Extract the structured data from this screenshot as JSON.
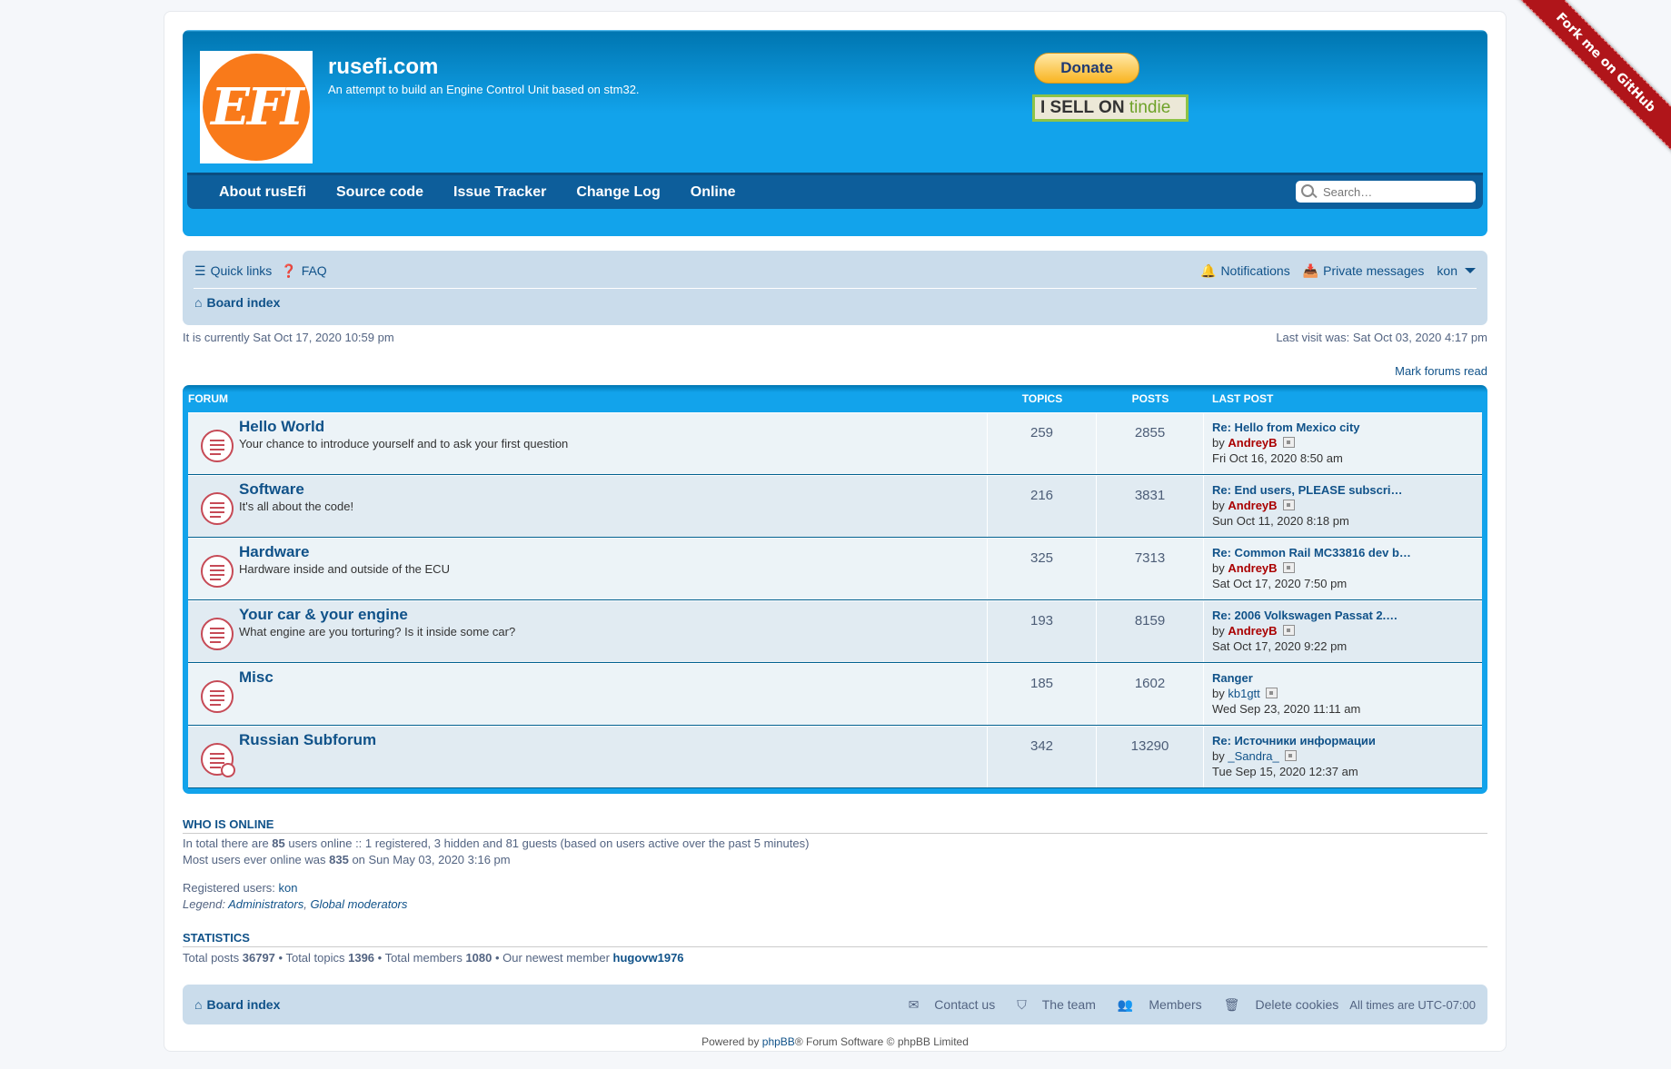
{
  "site": {
    "title": "rusefi.com",
    "description": "An attempt to build an Engine Control Unit based on stm32.",
    "logo_text": "EFI",
    "donate_label": "Donate",
    "tindie_prefix": "I SELL ON ",
    "tindie_brand": "tindie",
    "ribbon": "Fork me on GitHub"
  },
  "nav": {
    "items": [
      "About rusEfi",
      "Source code",
      "Issue Tracker",
      "Change Log",
      "Online"
    ],
    "search_placeholder": "Search…"
  },
  "crumbs": {
    "quick_links": "Quick links",
    "faq": "FAQ",
    "notifications": "Notifications",
    "private_messages": "Private messages",
    "username": "kon",
    "board_index": "Board index"
  },
  "time": {
    "current": "It is currently Sat Oct 17, 2020 10:59 pm",
    "last_visit": "Last visit was: Sat Oct 03, 2020 4:17 pm",
    "mark_read": "Mark forums read"
  },
  "forum_table": {
    "headers": [
      "Forum",
      "Topics",
      "Posts",
      "Last post"
    ],
    "rows": [
      {
        "title": "Hello World",
        "desc": "Your chance to introduce yourself and to ask your first question",
        "topics": "259",
        "posts": "2855",
        "last_title": "Re: Hello from Mexico city",
        "by": "by",
        "author": "AndreyB",
        "author_role": "admin",
        "date": "Fri Oct 16, 2020 8:50 am"
      },
      {
        "title": "Software",
        "desc": "It's all about the code!",
        "topics": "216",
        "posts": "3831",
        "last_title": "Re: End users, PLEASE subscri…",
        "by": "by",
        "author": "AndreyB",
        "author_role": "admin",
        "date": "Sun Oct 11, 2020 8:18 pm"
      },
      {
        "title": "Hardware",
        "desc": "Hardware inside and outside of the ECU",
        "topics": "325",
        "posts": "7313",
        "last_title": "Re: Common Rail MC33816 dev b…",
        "by": "by",
        "author": "AndreyB",
        "author_role": "admin",
        "date": "Sat Oct 17, 2020 7:50 pm"
      },
      {
        "title": "Your car & your engine",
        "desc": "What engine are you torturing? Is it inside some car?",
        "topics": "193",
        "posts": "8159",
        "last_title": "Re: 2006 Volkswagen Passat 2.…",
        "by": "by",
        "author": "AndreyB",
        "author_role": "admin",
        "date": "Sat Oct 17, 2020 9:22 pm"
      },
      {
        "title": "Misc",
        "desc": "",
        "topics": "185",
        "posts": "1602",
        "last_title": "Ranger",
        "by": "by",
        "author": "kb1gtt",
        "author_role": "user",
        "date": "Wed Sep 23, 2020 11:11 am"
      },
      {
        "title": "Russian Subforum",
        "desc": "",
        "topics": "342",
        "posts": "13290",
        "last_title": "Re: Источники информации",
        "by": "by",
        "author": "_Sandra_",
        "author_role": "user",
        "date": "Tue Sep 15, 2020 12:37 am"
      }
    ]
  },
  "online": {
    "heading": "Who is online",
    "line1_pre": "In total there are ",
    "line1_count": "85",
    "line1_post": " users online :: 1 registered, 3 hidden and 81 guests (based on users active over the past 5 minutes)",
    "line2_pre": "Most users ever online was ",
    "line2_count": "835",
    "line2_post": " on Sun May 03, 2020 3:16 pm",
    "registered_label": "Registered users: ",
    "registered_user": "kon",
    "legend_label": "Legend: ",
    "legend_admin": "Administrators",
    "legend_sep": ", ",
    "legend_mod": "Global moderators"
  },
  "stats": {
    "heading": "Statistics",
    "posts_label": "Total posts ",
    "posts": "36797",
    "topics_label": " • Total topics ",
    "topics": "1396",
    "members_label": " • Total members ",
    "members": "1080",
    "newest_label": " • Our newest member ",
    "newest": "hugovw1976"
  },
  "footer": {
    "board_index": "Board index",
    "contact": "Contact us",
    "team": "The team",
    "members": "Members",
    "delete_cookies": "Delete cookies",
    "timezone": "All times are UTC-07:00",
    "powered_pre": "Powered by ",
    "powered_link": "phpBB",
    "powered_post": "® Forum Software © phpBB Limited"
  },
  "colors": {
    "header_blue": "#12a3eb",
    "nav_dark": "#0d5e9b",
    "admin_red": "#aa0000",
    "mod_green": "#00aa00",
    "link_blue": "#105289"
  }
}
